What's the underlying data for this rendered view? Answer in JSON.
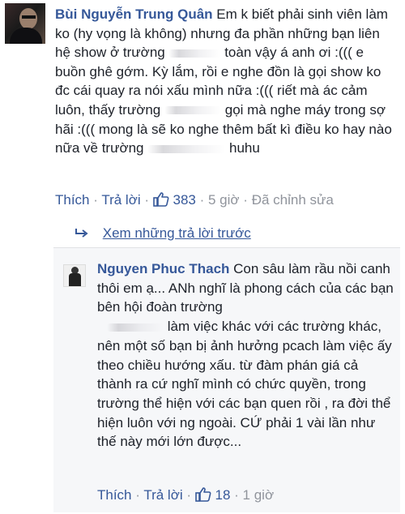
{
  "comment1": {
    "author": "Bùi Nguyễn Trung Quân",
    "text_parts": [
      "Em k biết phải sinh viên làm ko (hy vọng là không) nhưng đa phần những bạn liên hệ show ở trường",
      "toàn vậy á anh ơi :((( e buồn ghê gớm. Kỳ lắm, rồi e nghe đồn là gọi show ko đc cái quay ra nói xấu mình nữa :((( riết mà ác cảm luôn, thấy trường",
      "gọi mà nghe máy trong sợ hãi :((( mong là sẽ ko nghe thêm bất kì điều ko hay nào nữa về trường",
      "huhu"
    ],
    "actions": {
      "like": "Thích",
      "reply": "Trả lời",
      "like_count": "383",
      "time": "5 giờ",
      "edited": "Đã chỉnh sửa"
    }
  },
  "view_previous": {
    "label": "Xem những trả lời trước"
  },
  "reply1": {
    "author": "Nguyen Phuc Thach",
    "text_parts": [
      "Con sâu làm rầu nồi canh thôi em ạ... ANh nghĩ là phong cách của các bạn bên hội đoàn trường",
      "làm việc khác với các trường khác, nên một số bạn bị ảnh hưởng pcach làm việc ấy theo chiều hướng xấu. từ đàm phán giá cả thành ra cứ nghĩ mình có chức quyền, trong trường thể hiện với các bạn quen rồi , ra đời thể hiện luôn với ng ngoài. CỨ phải 1 vài lần như thế này mới lớn được..."
    ],
    "actions": {
      "like": "Thích",
      "reply": "Trả lời",
      "like_count": "18",
      "time": "1 giờ"
    }
  },
  "colors": {
    "link": "#365899",
    "meta": "#90949c",
    "text": "#1d2129",
    "reply_bg": "#f6f7f9"
  }
}
